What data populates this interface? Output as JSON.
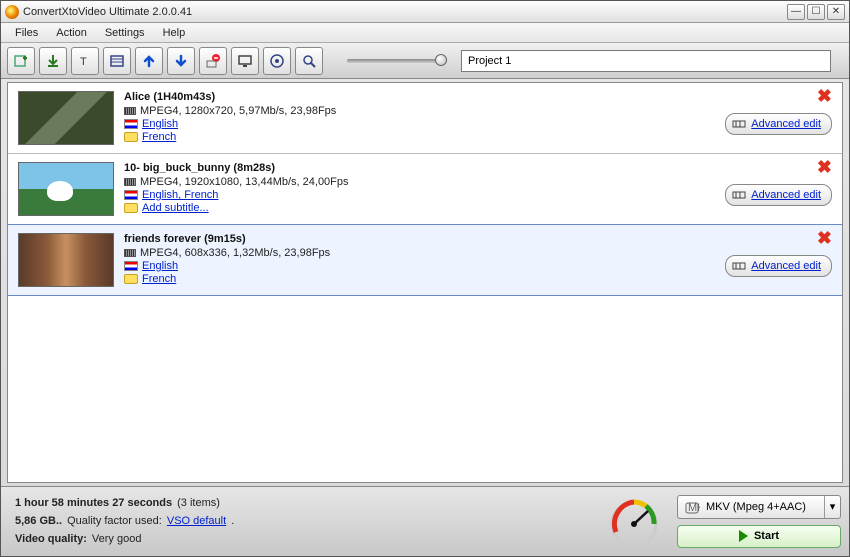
{
  "window": {
    "title": "ConvertXtoVideo Ultimate 2.0.0.41"
  },
  "menu": [
    "Files",
    "Action",
    "Settings",
    "Help"
  ],
  "project": {
    "name": "Project 1"
  },
  "labels": {
    "advanced_edit": "Advanced edit"
  },
  "items": [
    {
      "title": "Alice (1H40m43s)",
      "format": "MPEG4, 1280x720, 5,97Mb/s, 23,98Fps",
      "audio": "English",
      "subtitle": "French"
    },
    {
      "title": "10- big_buck_bunny (8m28s)",
      "format": "MPEG4, 1920x1080, 13,44Mb/s, 24,00Fps",
      "audio": "English, French",
      "subtitle": "Add subtitle..."
    },
    {
      "title": "friends forever (9m15s)",
      "format": "MPEG4, 608x336, 1,32Mb/s, 23,98Fps",
      "audio": "English",
      "subtitle": "French"
    }
  ],
  "summary": {
    "duration": "1 hour 58 minutes 27 seconds",
    "count": "(3 items)",
    "size": "5,86 GB..",
    "quality_factor_label": "Quality factor used:",
    "quality_factor_value": "VSO default",
    "video_quality_label": "Video quality:",
    "video_quality_value": "Very good"
  },
  "output": {
    "format": "MKV (Mpeg 4+AAC)",
    "start_label": "Start"
  }
}
